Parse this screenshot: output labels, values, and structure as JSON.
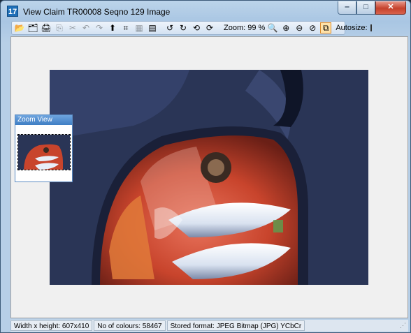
{
  "window": {
    "title": "View Claim TR00008 Seqno 129 Image",
    "app_icon_label": "17",
    "controls": {
      "minimize": "‒",
      "maximize": "□",
      "close": "✕"
    }
  },
  "toolbar": {
    "icons": [
      {
        "name": "open-folder-icon",
        "glyph": "📂",
        "enabled": true
      },
      {
        "name": "save-icon",
        "glyph": "🗂",
        "enabled": true
      },
      {
        "name": "print-icon",
        "glyph": "🖨",
        "enabled": true
      },
      {
        "name": "copy-icon",
        "glyph": "⎘",
        "enabled": false
      },
      {
        "name": "cut-icon",
        "glyph": "✂",
        "enabled": false
      },
      {
        "name": "undo-icon",
        "glyph": "↶",
        "enabled": false
      },
      {
        "name": "redo-icon",
        "glyph": "↷",
        "enabled": false
      },
      {
        "name": "image-export-icon",
        "glyph": "⬆",
        "enabled": true
      },
      {
        "name": "crop-icon",
        "glyph": "⌗",
        "enabled": true
      },
      {
        "name": "grid-icon",
        "glyph": "▦",
        "enabled": false
      },
      {
        "name": "page-icon",
        "glyph": "▤",
        "enabled": true
      }
    ],
    "rotate_icons": [
      {
        "name": "rotate-left-icon",
        "glyph": "↺"
      },
      {
        "name": "rotate-right-icon",
        "glyph": "↻"
      },
      {
        "name": "rotate-180-icon",
        "glyph": "⟲"
      },
      {
        "name": "flip-icon",
        "glyph": "⟳"
      }
    ],
    "zoom_label": "Zoom: 99 %",
    "zoom_icons": [
      {
        "name": "zoom-100-icon",
        "glyph": "🔍"
      },
      {
        "name": "zoom-in-icon",
        "glyph": "⊕"
      },
      {
        "name": "zoom-out-icon",
        "glyph": "⊖"
      },
      {
        "name": "zoom-fit-icon",
        "glyph": "⊘"
      },
      {
        "name": "zoom-window-icon",
        "glyph": "⧉"
      }
    ],
    "autosize_label": "Autosize:",
    "autosize_checked": false
  },
  "zoom_view": {
    "title": "Zoom View"
  },
  "statusbar": {
    "dimensions": "Width x height: 607x410",
    "colours": "No of colours: 58467",
    "format": "Stored format: JPEG Bitmap (JPG) YCbCr"
  }
}
